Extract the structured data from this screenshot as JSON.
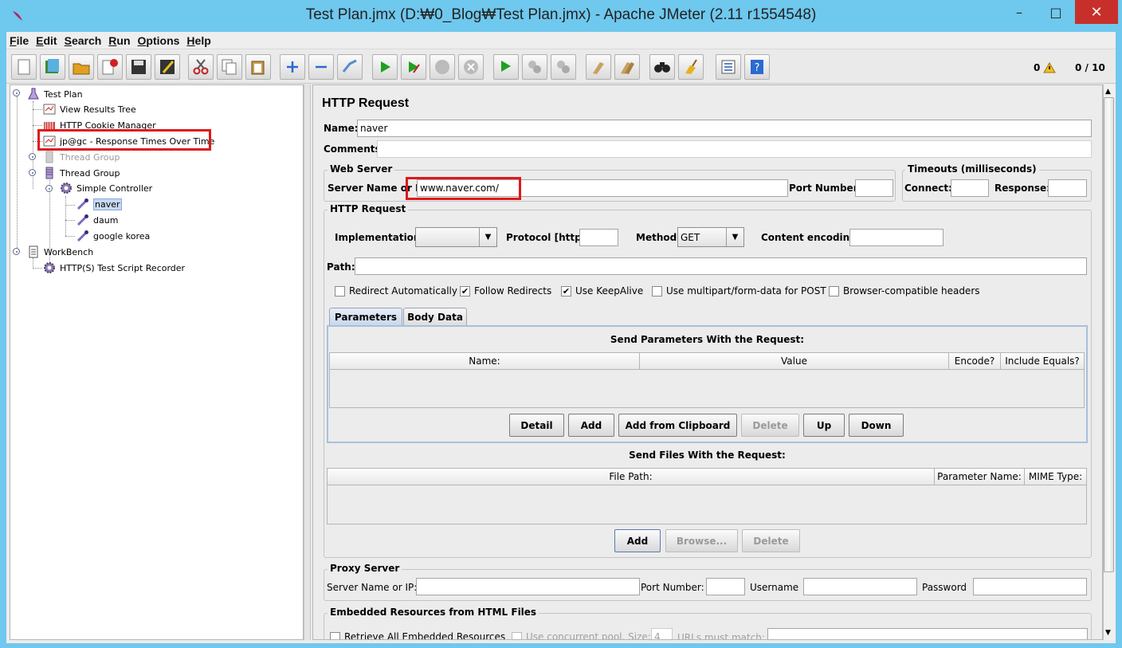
{
  "window": {
    "title": "Test Plan.jmx (D:₩0_Blog₩Test Plan.jmx) - Apache JMeter (2.11 r1554548)",
    "minimize": "–",
    "maximize": "□",
    "close": "✕"
  },
  "menu": [
    "File",
    "Edit",
    "Search",
    "Run",
    "Options",
    "Help"
  ],
  "toolbar": {
    "buttons": [
      "new-icon",
      "templates-icon",
      "open-icon",
      "close-plan-icon",
      "save-icon",
      "save-as-icon",
      "cut-icon",
      "copy-icon",
      "paste-icon",
      "expand-icon",
      "collapse-icon",
      "toggle-icon",
      "start-icon",
      "start-no-pause-icon",
      "stop-icon",
      "shutdown-icon",
      "remote-start-icon",
      "remote-stop-icon",
      "remote-shutdown-icon",
      "clear-icon",
      "clear-all-icon",
      "search-icon",
      "reset-search-icon",
      "function-helper-icon",
      "help-icon"
    ],
    "error_count": "0",
    "thread_count": "0 / 10"
  },
  "tree": {
    "test_plan": "Test Plan",
    "view_results_tree": "View Results Tree",
    "cookie_manager": "HTTP Cookie Manager",
    "response_times": "jp@gc - Response Times Over Time",
    "thread_group_disabled": "Thread Group",
    "thread_group": "Thread Group",
    "simple_controller": "Simple Controller",
    "naver": "naver",
    "daum": "daum",
    "google": "google korea",
    "workbench": "WorkBench",
    "recorder": "HTTP(S) Test Script Recorder"
  },
  "panel": {
    "heading": "HTTP Request",
    "name_label": "Name:",
    "name_value": "naver",
    "comments_label": "Comments:",
    "web_server": {
      "title": "Web Server",
      "server_label": "Server Name or IP:",
      "server_value": "www.naver.com/",
      "port_label": "Port Number:",
      "port_value": ""
    },
    "timeouts": {
      "title": "Timeouts (milliseconds)",
      "connect_label": "Connect:",
      "response_label": "Response:"
    },
    "http_request": {
      "title": "HTTP Request",
      "implementation_label": "Implementation:",
      "implementation_value": "",
      "protocol_label": "Protocol [http]:",
      "method_label": "Method:",
      "method_value": "GET",
      "encoding_label": "Content encoding:",
      "path_label": "Path:",
      "checkboxes": [
        {
          "label": "Redirect Automatically",
          "checked": false
        },
        {
          "label": "Follow Redirects",
          "checked": true
        },
        {
          "label": "Use KeepAlive",
          "checked": true
        },
        {
          "label": "Use multipart/form-data for POST",
          "checked": false
        },
        {
          "label": "Browser-compatible headers",
          "checked": false
        }
      ]
    },
    "tabs": [
      "Parameters",
      "Body Data"
    ],
    "params": {
      "title": "Send Parameters With the Request:",
      "columns": [
        "Name:",
        "Value",
        "Encode?",
        "Include Equals?"
      ],
      "buttons": [
        "Detail",
        "Add",
        "Add from Clipboard",
        "Delete",
        "Up",
        "Down"
      ]
    },
    "files": {
      "title": "Send Files With the Request:",
      "columns": [
        "File Path:",
        "Parameter Name:",
        "MIME Type:"
      ],
      "buttons": [
        "Add",
        "Browse...",
        "Delete"
      ]
    },
    "proxy": {
      "title": "Proxy Server",
      "server_label": "Server Name or IP:",
      "port_label": "Port Number:",
      "username_label": "Username",
      "password_label": "Password"
    },
    "embedded": {
      "title": "Embedded Resources from HTML Files",
      "retrieve_label": "Retrieve All Embedded Resources",
      "concurrent_label": "Use concurrent pool. Size:",
      "size_value": "4",
      "urls_label": "URLs must match:"
    }
  },
  "colors": {
    "highlight": "#e01818",
    "titlebar": "#6fc8ee",
    "close": "#c7302a"
  }
}
